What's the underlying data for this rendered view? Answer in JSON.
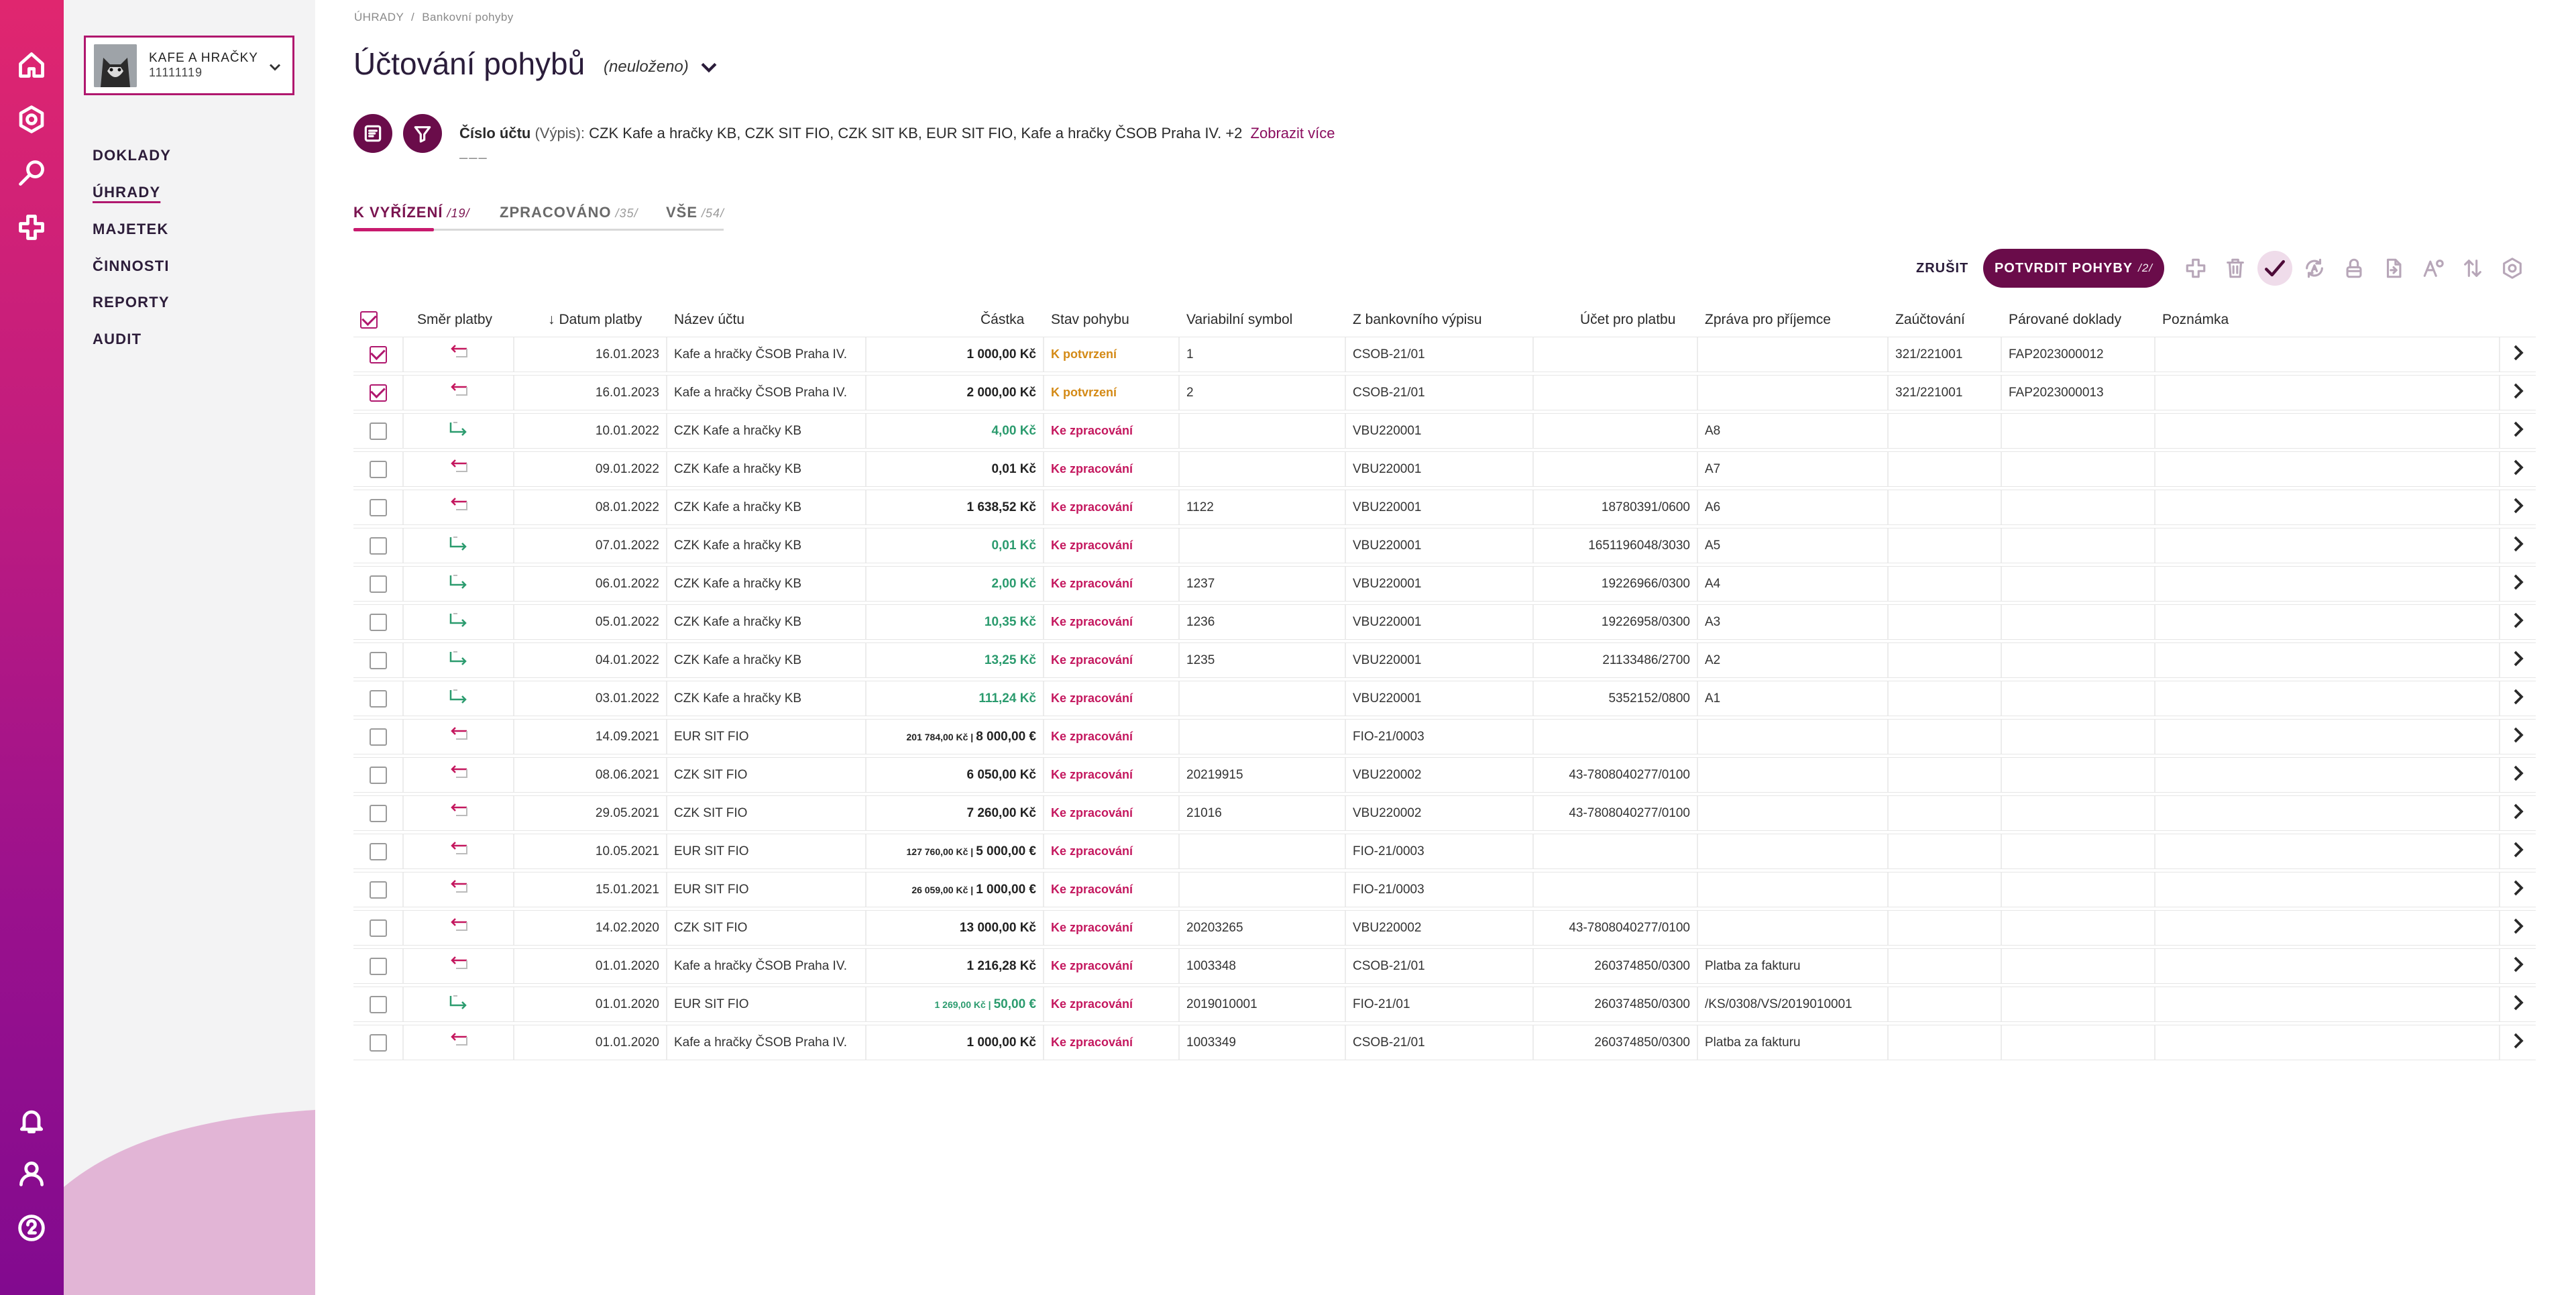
{
  "rail": {
    "icons": [
      "home-icon",
      "settings-icon",
      "search-icon",
      "add-icon",
      "bell-icon",
      "user-icon",
      "help-icon"
    ]
  },
  "company": {
    "name": "KAFE A HRAČKY",
    "id": "11111119"
  },
  "nav": {
    "items": [
      {
        "label": "DOKLADY",
        "active": false
      },
      {
        "label": "ÚHRADY",
        "active": true
      },
      {
        "label": "MAJETEK",
        "active": false
      },
      {
        "label": "ČINNOSTI",
        "active": false
      },
      {
        "label": "REPORTY",
        "active": false
      },
      {
        "label": "AUDIT",
        "active": false
      }
    ]
  },
  "breadcrumb": {
    "root": "ÚHRADY",
    "sep": "/",
    "current": "Bankovní pohyby"
  },
  "header": {
    "title": "Účtování pohybů",
    "status": "(neuloženo)"
  },
  "filter": {
    "label": "Číslo účtu",
    "sublabel": "(Výpis):",
    "value": "CZK Kafe a hračky KB, CZK SIT FIO, CZK SIT KB, EUR SIT FIO, Kafe a hračky ČSOB Praha IV.",
    "extra": "+2",
    "more": "Zobrazit více",
    "dash": "–––"
  },
  "tabs": [
    {
      "label": "K VYŘÍZENÍ",
      "count": "/19/",
      "active": true
    },
    {
      "label": "ZPRACOVÁNO",
      "count": "/35/",
      "active": false
    },
    {
      "label": "VŠE",
      "count": "/54/",
      "active": false
    }
  ],
  "actions": {
    "cancel": "ZRUŠIT",
    "confirm": "POTVRDIT POHYBY",
    "confirm_count": "/2/"
  },
  "toolbar": [
    "add-icon",
    "trash-icon",
    "check-icon",
    "auto-sync-icon",
    "lock-icon",
    "export-icon",
    "font-settings-icon",
    "sort-icon",
    "settings-icon"
  ],
  "columns": {
    "direction": "Směr platby",
    "date": "Datum platby",
    "account": "Název účtu",
    "amount": "Částka",
    "state": "Stav pohybu",
    "vs": "Variabilní symbol",
    "statement": "Z bankovního výpisu",
    "pay_account": "Účet pro platbu",
    "message": "Zpráva pro příjemce",
    "posting": "Zaúčtování",
    "docs": "Párované doklady",
    "note": "Poznámka"
  },
  "rows": [
    {
      "checked": true,
      "dir": "out",
      "date": "16.01.2023",
      "account": "Kafe a hračky ČSOB Praha IV.",
      "amount_sub": "",
      "amount": "1 000,00 Kč",
      "state": "K potvrzení",
      "state_type": "conf",
      "vs": "1",
      "statement": "CSOB-21/01",
      "pay_account": "",
      "message": "",
      "posting": "321/221001",
      "docs": "FAP2023000012",
      "note": ""
    },
    {
      "checked": true,
      "dir": "out",
      "date": "16.01.2023",
      "account": "Kafe a hračky ČSOB Praha IV.",
      "amount_sub": "",
      "amount": "2 000,00 Kč",
      "state": "K potvrzení",
      "state_type": "conf",
      "vs": "2",
      "statement": "CSOB-21/01",
      "pay_account": "",
      "message": "",
      "posting": "321/221001",
      "docs": "FAP2023000013",
      "note": ""
    },
    {
      "checked": false,
      "dir": "in",
      "date": "10.01.2022",
      "account": "CZK Kafe a hračky KB",
      "amount_sub": "",
      "amount": "4,00 Kč",
      "state": "Ke zpracování",
      "state_type": "proc",
      "vs": "",
      "statement": "VBU220001",
      "pay_account": "",
      "message": "A8",
      "posting": "",
      "docs": "",
      "note": ""
    },
    {
      "checked": false,
      "dir": "out",
      "date": "09.01.2022",
      "account": "CZK Kafe a hračky KB",
      "amount_sub": "",
      "amount": "0,01 Kč",
      "state": "Ke zpracování",
      "state_type": "proc",
      "vs": "",
      "statement": "VBU220001",
      "pay_account": "",
      "message": "A7",
      "posting": "",
      "docs": "",
      "note": ""
    },
    {
      "checked": false,
      "dir": "out",
      "date": "08.01.2022",
      "account": "CZK Kafe a hračky KB",
      "amount_sub": "",
      "amount": "1 638,52 Kč",
      "state": "Ke zpracování",
      "state_type": "proc",
      "vs": "1122",
      "statement": "VBU220001",
      "pay_account": "18780391/0600",
      "message": "A6",
      "posting": "",
      "docs": "",
      "note": ""
    },
    {
      "checked": false,
      "dir": "in",
      "date": "07.01.2022",
      "account": "CZK Kafe a hračky KB",
      "amount_sub": "",
      "amount": "0,01 Kč",
      "state": "Ke zpracování",
      "state_type": "proc",
      "vs": "",
      "statement": "VBU220001",
      "pay_account": "1651196048/3030",
      "message": "A5",
      "posting": "",
      "docs": "",
      "note": ""
    },
    {
      "checked": false,
      "dir": "in",
      "date": "06.01.2022",
      "account": "CZK Kafe a hračky KB",
      "amount_sub": "",
      "amount": "2,00 Kč",
      "state": "Ke zpracování",
      "state_type": "proc",
      "vs": "1237",
      "statement": "VBU220001",
      "pay_account": "19226966/0300",
      "message": "A4",
      "posting": "",
      "docs": "",
      "note": ""
    },
    {
      "checked": false,
      "dir": "in",
      "date": "05.01.2022",
      "account": "CZK Kafe a hračky KB",
      "amount_sub": "",
      "amount": "10,35 Kč",
      "state": "Ke zpracování",
      "state_type": "proc",
      "vs": "1236",
      "statement": "VBU220001",
      "pay_account": "19226958/0300",
      "message": "A3",
      "posting": "",
      "docs": "",
      "note": ""
    },
    {
      "checked": false,
      "dir": "in",
      "date": "04.01.2022",
      "account": "CZK Kafe a hračky KB",
      "amount_sub": "",
      "amount": "13,25 Kč",
      "state": "Ke zpracování",
      "state_type": "proc",
      "vs": "1235",
      "statement": "VBU220001",
      "pay_account": "21133486/2700",
      "message": "A2",
      "posting": "",
      "docs": "",
      "note": ""
    },
    {
      "checked": false,
      "dir": "in",
      "date": "03.01.2022",
      "account": "CZK Kafe a hračky KB",
      "amount_sub": "",
      "amount": "111,24 Kč",
      "state": "Ke zpracování",
      "state_type": "proc",
      "vs": "",
      "statement": "VBU220001",
      "pay_account": "5352152/0800",
      "message": "A1",
      "posting": "",
      "docs": "",
      "note": ""
    },
    {
      "checked": false,
      "dir": "out",
      "date": "14.09.2021",
      "account": "EUR SIT FIO",
      "amount_sub": "201 784,00 Kč |",
      "amount": "8 000,00 €",
      "state": "Ke zpracování",
      "state_type": "proc",
      "vs": "",
      "statement": "FIO-21/0003",
      "pay_account": "",
      "message": "",
      "posting": "",
      "docs": "",
      "note": ""
    },
    {
      "checked": false,
      "dir": "out",
      "date": "08.06.2021",
      "account": "CZK SIT FIO",
      "amount_sub": "",
      "amount": "6 050,00 Kč",
      "state": "Ke zpracování",
      "state_type": "proc",
      "vs": "20219915",
      "statement": "VBU220002",
      "pay_account": "43-7808040277/0100",
      "message": "",
      "posting": "",
      "docs": "",
      "note": ""
    },
    {
      "checked": false,
      "dir": "out",
      "date": "29.05.2021",
      "account": "CZK SIT FIO",
      "amount_sub": "",
      "amount": "7 260,00 Kč",
      "state": "Ke zpracování",
      "state_type": "proc",
      "vs": "21016",
      "statement": "VBU220002",
      "pay_account": "43-7808040277/0100",
      "message": "",
      "posting": "",
      "docs": "",
      "note": ""
    },
    {
      "checked": false,
      "dir": "out",
      "date": "10.05.2021",
      "account": "EUR SIT FIO",
      "amount_sub": "127 760,00 Kč |",
      "amount": "5 000,00 €",
      "state": "Ke zpracování",
      "state_type": "proc",
      "vs": "",
      "statement": "FIO-21/0003",
      "pay_account": "",
      "message": "",
      "posting": "",
      "docs": "",
      "note": ""
    },
    {
      "checked": false,
      "dir": "out",
      "date": "15.01.2021",
      "account": "EUR SIT FIO",
      "amount_sub": "26 059,00 Kč |",
      "amount": "1 000,00 €",
      "state": "Ke zpracování",
      "state_type": "proc",
      "vs": "",
      "statement": "FIO-21/0003",
      "pay_account": "",
      "message": "",
      "posting": "",
      "docs": "",
      "note": ""
    },
    {
      "checked": false,
      "dir": "out",
      "date": "14.02.2020",
      "account": "CZK SIT FIO",
      "amount_sub": "",
      "amount": "13 000,00 Kč",
      "state": "Ke zpracování",
      "state_type": "proc",
      "vs": "20203265",
      "statement": "VBU220002",
      "pay_account": "43-7808040277/0100",
      "message": "",
      "posting": "",
      "docs": "",
      "note": ""
    },
    {
      "checked": false,
      "dir": "out",
      "date": "01.01.2020",
      "account": "Kafe a hračky ČSOB Praha IV.",
      "amount_sub": "",
      "amount": "1 216,28 Kč",
      "state": "Ke zpracování",
      "state_type": "proc",
      "vs": "1003348",
      "statement": "CSOB-21/01",
      "pay_account": "260374850/0300",
      "message": "Platba za fakturu",
      "posting": "",
      "docs": "",
      "note": ""
    },
    {
      "checked": false,
      "dir": "in",
      "date": "01.01.2020",
      "account": "EUR SIT FIO",
      "amount_sub": "1 269,00 Kč |",
      "amount": "50,00 €",
      "state": "Ke zpracování",
      "state_type": "proc",
      "vs": "2019010001",
      "statement": "FIO-21/01",
      "pay_account": "260374850/0300",
      "message": "/KS/0308/VS/2019010001",
      "posting": "",
      "docs": "",
      "note": ""
    },
    {
      "checked": false,
      "dir": "out",
      "date": "01.01.2020",
      "account": "Kafe a hračky ČSOB Praha IV.",
      "amount_sub": "",
      "amount": "1 000,00 Kč",
      "state": "Ke zpracování",
      "state_type": "proc",
      "vs": "1003349",
      "statement": "CSOB-21/01",
      "pay_account": "260374850/0300",
      "message": "Platba za fakturu",
      "posting": "",
      "docs": "",
      "note": ""
    }
  ],
  "colors": {
    "accent": "#b0176e",
    "primary": "#6a0c4a",
    "positive": "#2b9b6e",
    "warning": "#d48a16",
    "alert": "#c4175e"
  }
}
